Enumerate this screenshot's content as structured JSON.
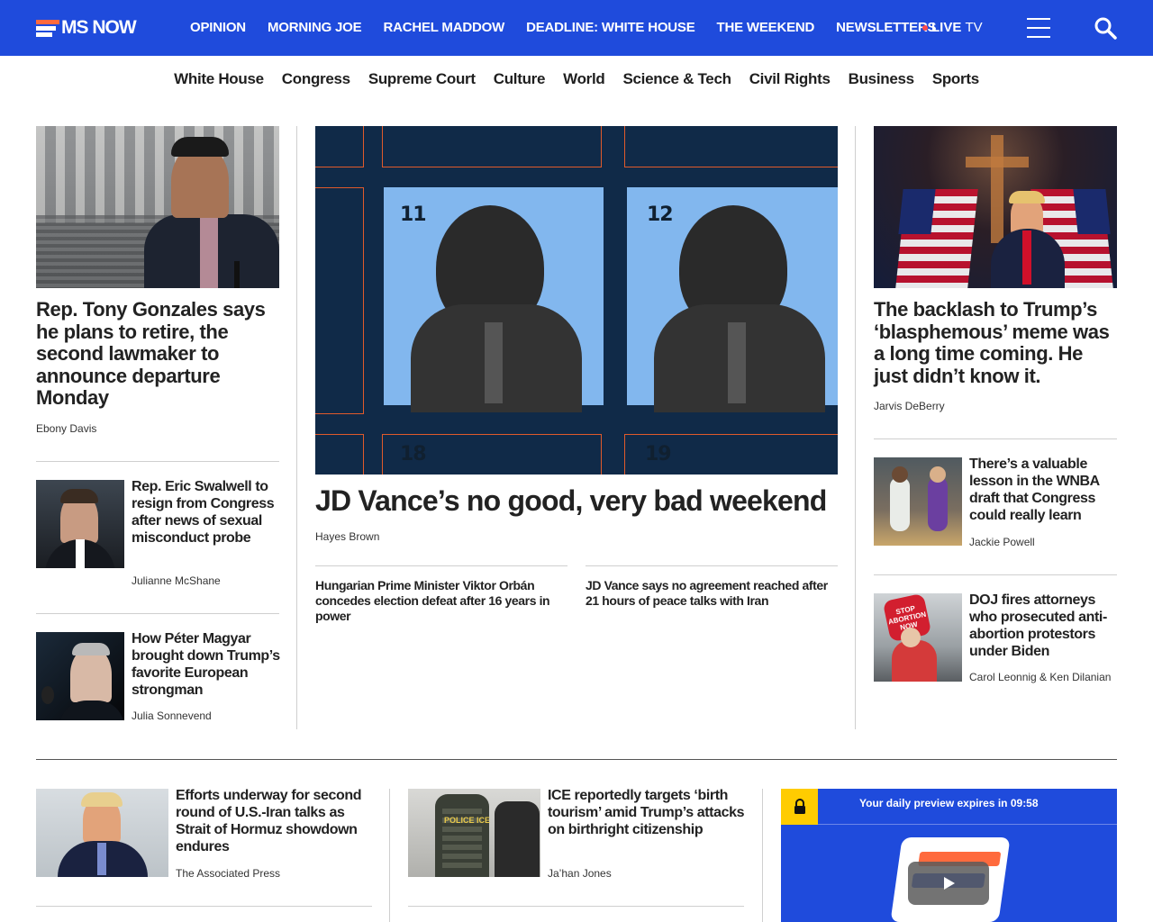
{
  "brand": {
    "name": "MS NOW",
    "accent": "#1f4bdc",
    "logo_stripe": "#ff6a3d"
  },
  "topnav": {
    "items": [
      "OPINION",
      "MORNING JOE",
      "RACHEL MADDOW",
      "DEADLINE: WHITE HOUSE",
      "THE WEEKEND",
      "NEWSLETTERS"
    ],
    "live_label": "LIVE",
    "live_suffix": "TV",
    "menu_icon": "hamburger-icon",
    "search_icon": "search-icon"
  },
  "sections": [
    "White House",
    "Congress",
    "Supreme Court",
    "Culture",
    "World",
    "Science & Tech",
    "Civil Rights",
    "Business",
    "Sports"
  ],
  "left_col": {
    "lead": {
      "headline": "Rep. Tony Gonzales says he plans to retire, the second lawmaker to announce departure Monday",
      "byline": "Ebony Davis"
    },
    "items": [
      {
        "headline": "Rep. Eric Swalwell to resign from Congress after news of sexual misconduct probe",
        "byline": "Julianne McShane"
      },
      {
        "headline": "How Péter Magyar brought down Trump’s favorite European strongman",
        "byline": "Julia Sonnevend"
      }
    ]
  },
  "center_col": {
    "lead": {
      "headline": "JD Vance’s no good, very bad weekend",
      "byline": "Hayes Brown",
      "art_numbers": [
        "11",
        "12",
        "18",
        "19"
      ]
    },
    "related": [
      {
        "headline": "Hungarian Prime Minister Viktor Orbán concedes election defeat after 16 years in power"
      },
      {
        "headline": "JD Vance says no agreement reached after 21 hours of peace talks with Iran"
      }
    ]
  },
  "right_col": {
    "lead": {
      "headline": "The backlash to Trump’s ‘blasphemous’ meme was a long time coming. He just didn’t know it.",
      "byline": "Jarvis DeBerry"
    },
    "items": [
      {
        "headline": "There’s a valuable lesson in the WNBA draft that Congress could really learn",
        "byline": "Jackie Powell"
      },
      {
        "headline": "DOJ fires attorneys who prosecuted anti-abortion protestors under Biden",
        "byline": "Carol Leonnig & Ken Dilanian",
        "photo_sign": "STOP ABORTION NOW"
      }
    ]
  },
  "bottom_row": {
    "items": [
      {
        "headline": "Efforts underway for second round of U.S.-Iran talks as Strait of Hormuz showdown endures",
        "byline": "The Associated Press"
      },
      {
        "headline": "ICE reportedly targets ‘birth tourism’ amid Trump’s attacks on birthright citizenship",
        "byline": "Ja’han Jones",
        "photo_text": "POLICE ICE"
      }
    ],
    "promo": {
      "text": "Your daily preview expires in 09:58",
      "lock_icon": "lock-icon",
      "play_icon": "play-icon",
      "lock_color": "#ffcc00"
    }
  }
}
